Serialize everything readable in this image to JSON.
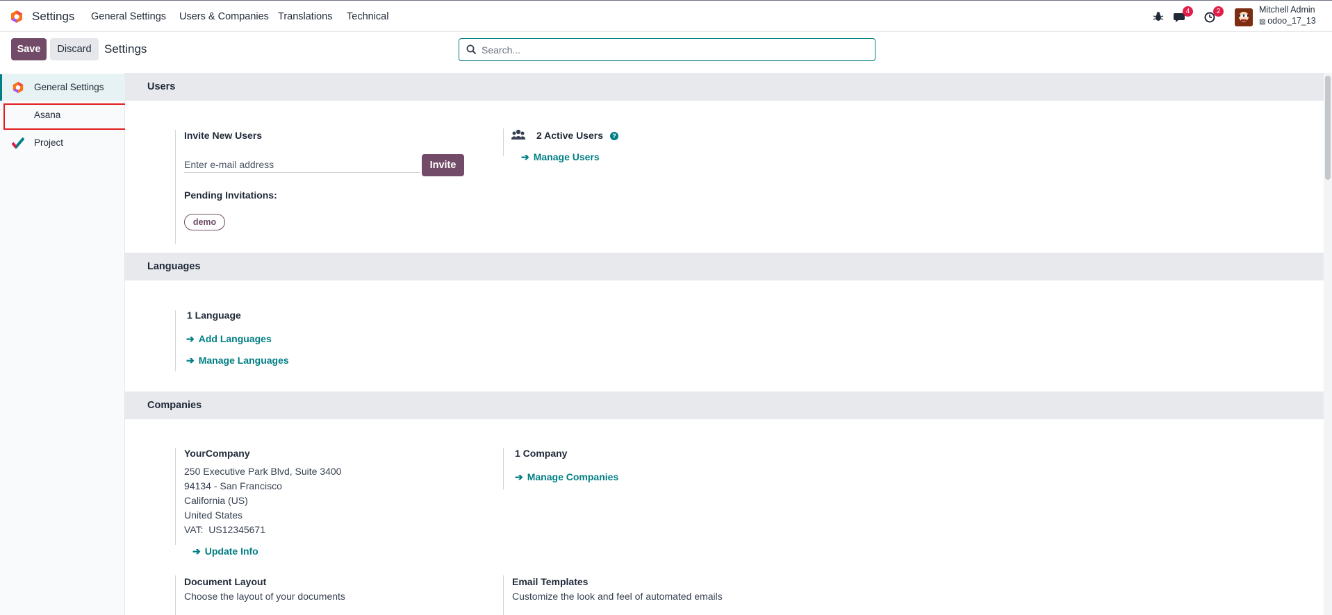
{
  "navbar": {
    "app_title": "Settings",
    "menu": [
      "General Settings",
      "Users & Companies",
      "Translations",
      "Technical"
    ],
    "chat_badge": "4",
    "activity_badge": "2",
    "user_name": "Mitchell Admin",
    "database": "odoo_17_13"
  },
  "control_panel": {
    "save_label": "Save",
    "discard_label": "Discard",
    "title": "Settings",
    "search_placeholder": "Search..."
  },
  "sidebar": {
    "items": [
      {
        "label": "General Settings",
        "icon": "odoo-logo-icon",
        "active": true
      },
      {
        "label": "Asana",
        "icon": "",
        "active": false
      },
      {
        "label": "Project",
        "icon": "project-check-icon",
        "active": false
      }
    ]
  },
  "users_section": {
    "title": "Users",
    "invite_title": "Invite New Users",
    "email_placeholder": "Enter e-mail address",
    "invite_label": "Invite",
    "pending_label": "Pending Invitations:",
    "pending_tags": [
      "demo"
    ],
    "active_users": "2 Active Users",
    "manage_users": "Manage Users"
  },
  "languages_section": {
    "title": "Languages",
    "count": "1 Language",
    "add_languages": "Add Languages",
    "manage_languages": "Manage Languages"
  },
  "companies_section": {
    "title": "Companies",
    "company_name": "YourCompany",
    "address_lines": [
      "250 Executive Park Blvd, Suite 3400",
      "94134 - San Francisco",
      "California (US)",
      "United States",
      "VAT:  US12345671"
    ],
    "update_info": "Update Info",
    "company_count": "1 Company",
    "manage_companies": "Manage Companies",
    "document_layout_title": "Document Layout",
    "document_layout_desc": "Choose the layout of your documents",
    "email_templates_title": "Email Templates",
    "email_templates_desc": "Customize the look and feel of automated emails"
  },
  "colors": {
    "brand": "#714B67",
    "accent": "#017e84",
    "badge": "#e11d48"
  }
}
